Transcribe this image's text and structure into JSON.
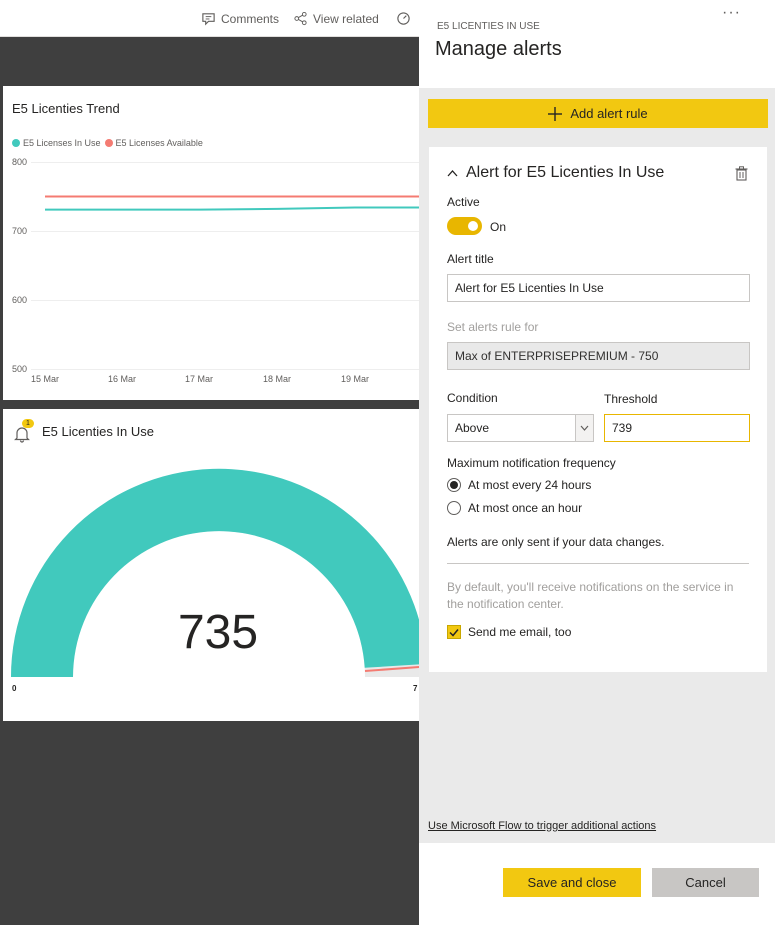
{
  "topbar": {
    "comments_label": "Comments",
    "view_related_label": "View related",
    "comments_icon": "comment-icon",
    "view_related_icon": "share-nodes-icon"
  },
  "trend_tile": {
    "title": "E5 Licenties Trend",
    "chart_data": {
      "type": "line",
      "x": [
        "15 Mar",
        "16 Mar",
        "17 Mar",
        "18 Mar",
        "19 Mar"
      ],
      "series": [
        {
          "name": "E5 Licenses In Use",
          "color": "#41c9bd",
          "values": [
            731,
            731,
            731,
            732,
            734
          ]
        },
        {
          "name": "E5 Licenses Available",
          "color": "#f47b72",
          "values": [
            750,
            750,
            750,
            750,
            750
          ]
        }
      ],
      "yticks": [
        "800",
        "700",
        "600",
        "500"
      ],
      "ylim": [
        500,
        800
      ],
      "grid": true,
      "legend": "top-left"
    }
  },
  "gauge_tile": {
    "title": "E5 Licenties In Use",
    "alert_badge": "1",
    "value": "735",
    "min_label": "0",
    "max_label": "7",
    "fill_color": "#41c9bd",
    "target_color": "#f47b72"
  },
  "pane": {
    "subtitle": "E5 LICENTIES IN USE",
    "title": "Manage alerts",
    "more_label": "···",
    "add_rule_label": "Add alert rule",
    "card": {
      "header": "Alert for E5 Licenties In Use",
      "active_label": "Active",
      "toggle_state": "On",
      "alert_title_label": "Alert title",
      "alert_title_value": "Alert for E5 Licenties In Use",
      "rule_for_label": "Set alerts rule for",
      "rule_for_value": "Max of ENTERPRISEPREMIUM - 750",
      "condition_label": "Condition",
      "condition_value": "Above",
      "threshold_label": "Threshold",
      "threshold_value": "739",
      "frequency_label": "Maximum notification frequency",
      "frequency_options": [
        "At most every 24 hours",
        "At most once an hour"
      ],
      "frequency_selected": 0,
      "data_change_note": "Alerts are only sent if your data changes.",
      "default_note": "By default, you'll receive notifications on the service in the notification center.",
      "email_label": "Send me email, too",
      "email_checked": true
    },
    "flow_link": "Use Microsoft Flow to trigger additional actions",
    "save_label": "Save and close",
    "cancel_label": "Cancel",
    "accent_color": "#f2c811"
  }
}
